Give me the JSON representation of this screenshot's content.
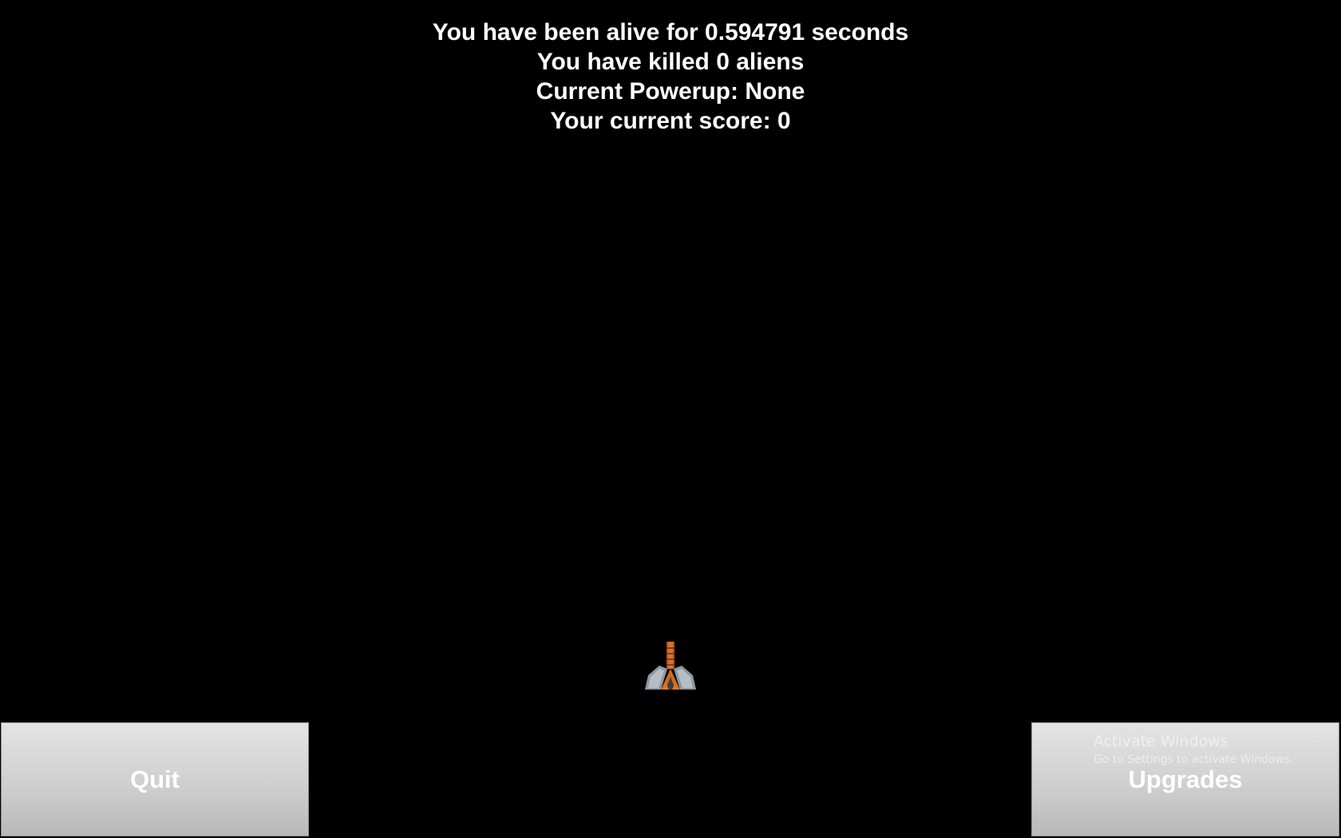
{
  "hud": {
    "alive_text": "You have been alive for 0.594791 seconds",
    "killed_text": "You have killed 0 aliens",
    "powerup_text": "Current Powerup: None",
    "score_text": "Your current score: 0"
  },
  "player": {
    "icon": "spaceship-icon",
    "colors": {
      "body": "#c0622a",
      "wing": "#9aa3ab",
      "accent": "#e07a2e"
    }
  },
  "buttons": {
    "quit_label": "Quit",
    "upgrades_label": "Upgrades"
  },
  "watermark": {
    "title": "Activate Windows",
    "subtitle": "Go to Settings to activate Windows."
  }
}
